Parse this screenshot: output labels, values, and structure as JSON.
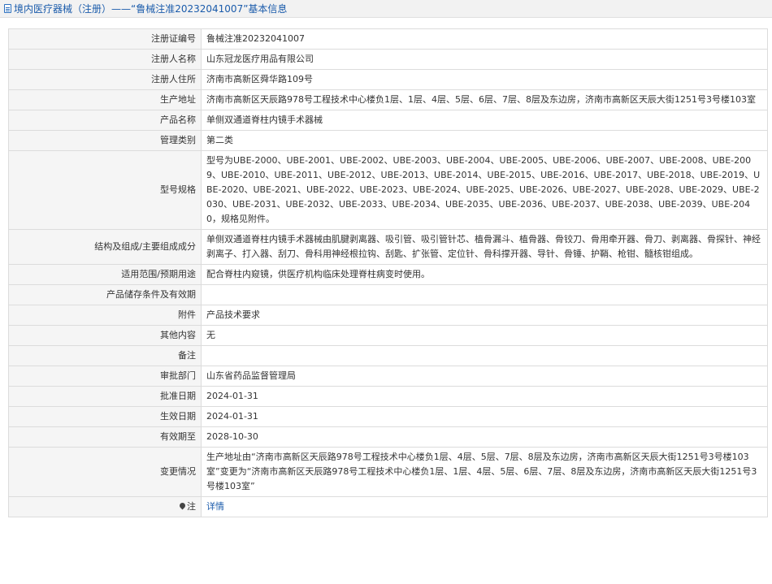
{
  "header": {
    "title": "境内医疗器械（注册）——“鲁械注准20232041007”基本信息",
    "icon": "document-icon"
  },
  "colors": {
    "accent": "#1a5bab",
    "label_bg": "#f5f5f5",
    "border": "#dcdcdc"
  },
  "rows": [
    {
      "label": "注册证编号",
      "value": "鲁械注准20232041007"
    },
    {
      "label": "注册人名称",
      "value": "山东冠龙医疗用品有限公司"
    },
    {
      "label": "注册人住所",
      "value": "济南市高新区舜华路109号"
    },
    {
      "label": "生产地址",
      "value": "济南市高新区天辰路978号工程技术中心楼负1层、1层、4层、5层、6层、7层、8层及东边房，济南市高新区天辰大街1251号3号楼103室"
    },
    {
      "label": "产品名称",
      "value": "单侧双通道脊柱内镜手术器械"
    },
    {
      "label": "管理类别",
      "value": "第二类"
    },
    {
      "label": "型号规格",
      "value": "型号为UBE-2000、UBE-2001、UBE-2002、UBE-2003、UBE-2004、UBE-2005、UBE-2006、UBE-2007、UBE-2008、UBE-2009、UBE-2010、UBE-2011、UBE-2012、UBE-2013、UBE-2014、UBE-2015、UBE-2016、UBE-2017、UBE-2018、UBE-2019、UBE-2020、UBE-2021、UBE-2022、UBE-2023、UBE-2024、UBE-2025、UBE-2026、UBE-2027、UBE-2028、UBE-2029、UBE-2030、UBE-2031、UBE-2032、UBE-2033、UBE-2034、UBE-2035、UBE-2036、UBE-2037、UBE-2038、UBE-2039、UBE-2040，规格见附件。"
    },
    {
      "label": "结构及组成/主要组成成分",
      "value": "单侧双通道脊柱内镜手术器械由肌腱剥离器、吸引管、吸引管针芯、植骨漏斗、植骨器、骨铰刀、骨用牵开器、骨刀、剥离器、骨探针、神经剥离子、打入器、刮刀、骨科用神经根拉钩、刮匙、扩张管、定位针、骨科撑开器、导针、骨锤、护鞘、枪钳、髓核钳组成。"
    },
    {
      "label": "适用范围/预期用途",
      "value": "配合脊柱内窥镜，供医疗机构临床处理脊柱病变时使用。"
    },
    {
      "label": "产品储存条件及有效期",
      "value": ""
    },
    {
      "label": "附件",
      "value": "产品技术要求"
    },
    {
      "label": "其他内容",
      "value": "无"
    },
    {
      "label": "备注",
      "value": ""
    },
    {
      "label": "审批部门",
      "value": "山东省药品监督管理局"
    },
    {
      "label": "批准日期",
      "value": "2024-01-31"
    },
    {
      "label": "生效日期",
      "value": "2024-01-31"
    },
    {
      "label": "有效期至",
      "value": "2028-10-30"
    },
    {
      "label": "变更情况",
      "value": "生产地址由“济南市高新区天辰路978号工程技术中心楼负1层、4层、5层、7层、8层及东边房，济南市高新区天辰大街1251号3号楼103室”变更为“济南市高新区天辰路978号工程技术中心楼负1层、1层、4层、5层、6层、7层、8层及东边房，济南市高新区天辰大街1251号3号楼103室”"
    }
  ],
  "note_row": {
    "label": "注",
    "icon": "pin-icon",
    "link_text": "详情"
  }
}
